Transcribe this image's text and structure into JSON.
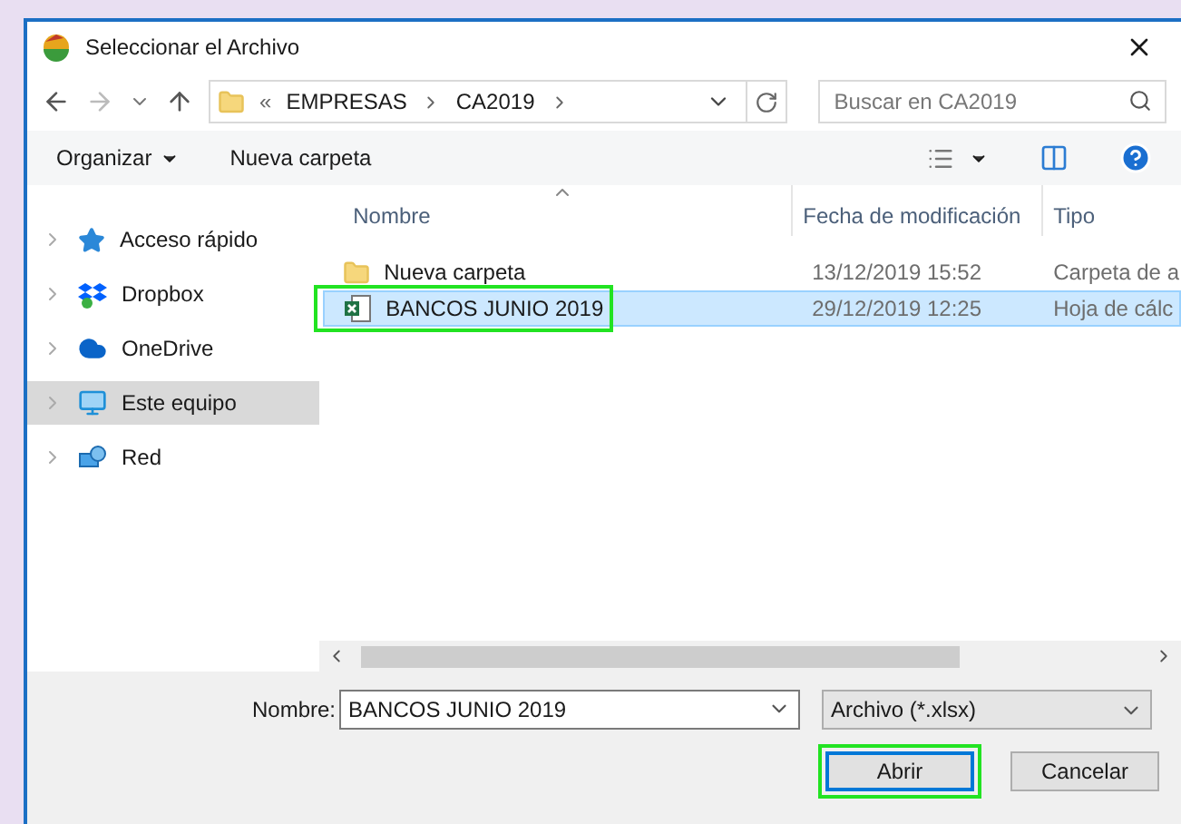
{
  "window": {
    "title": "Seleccionar el Archivo"
  },
  "address": {
    "overflow": "«",
    "path": [
      "EMPRESAS",
      "CA2019"
    ]
  },
  "search": {
    "placeholder": "Buscar en CA2019"
  },
  "toolbar": {
    "organize": "Organizar",
    "new_folder": "Nueva carpeta"
  },
  "sidebar": {
    "items": [
      {
        "label": "Acceso rápido",
        "kind": "star",
        "selected": false
      },
      {
        "label": "Dropbox",
        "kind": "dropbox",
        "selected": false
      },
      {
        "label": "OneDrive",
        "kind": "cloud",
        "selected": false
      },
      {
        "label": "Este equipo",
        "kind": "computer",
        "selected": true
      },
      {
        "label": "Red",
        "kind": "network",
        "selected": false
      }
    ]
  },
  "table": {
    "columns": [
      "Nombre",
      "Fecha de modificación",
      "Tipo"
    ],
    "rows": [
      {
        "kind": "folder",
        "name": "Nueva carpeta",
        "date": "13/12/2019 15:52",
        "type": "Carpeta de a",
        "selected": false,
        "highlighted": false
      },
      {
        "kind": "excel",
        "name": "BANCOS JUNIO 2019",
        "date": "29/12/2019 12:25",
        "type": "Hoja de cálc",
        "selected": true,
        "highlighted": true
      }
    ]
  },
  "filename": {
    "label": "Nombre:",
    "value": "BANCOS JUNIO 2019"
  },
  "filter": {
    "value": "Archivo (*.xlsx)"
  },
  "buttons": [
    {
      "label": "Abrir",
      "highlighted": true,
      "default": true
    },
    {
      "label": "Cancelar",
      "highlighted": false,
      "default": false
    }
  ]
}
